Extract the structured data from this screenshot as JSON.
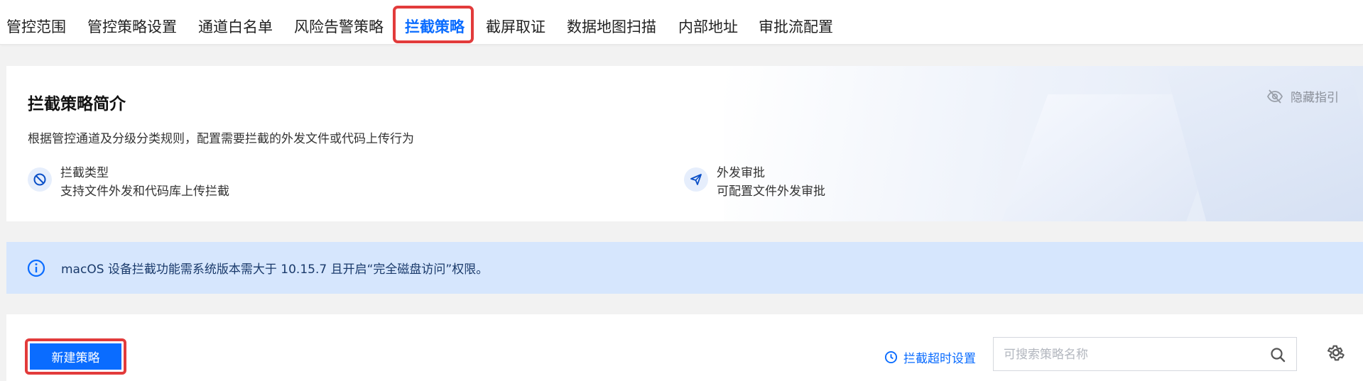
{
  "tabs": [
    {
      "label": "管控范围"
    },
    {
      "label": "管控策略设置"
    },
    {
      "label": "通道白名单"
    },
    {
      "label": "风险告警策略"
    },
    {
      "label": "拦截策略",
      "active": true
    },
    {
      "label": "截屏取证"
    },
    {
      "label": "数据地图扫描"
    },
    {
      "label": "内部地址"
    },
    {
      "label": "审批流配置"
    }
  ],
  "intro": {
    "title": "拦截策略简介",
    "description": "根据管控通道及分级分类规则，配置需要拦截的外发文件或代码上传行为",
    "hide_guide_label": "隐藏指引",
    "features": [
      {
        "icon": "block-icon",
        "title": "拦截类型",
        "desc": "支持文件外发和代码库上传拦截"
      },
      {
        "icon": "send-icon",
        "title": "外发审批",
        "desc": "可配置文件外发审批"
      }
    ]
  },
  "notice": {
    "text": "macOS 设备拦截功能需系统版本需大于 10.15.7 且开启“完全磁盘访问”权限。"
  },
  "toolbar": {
    "new_button": "新建策略",
    "timeout_link": "拦截超时设置",
    "search_placeholder": "可搜索策略名称"
  },
  "colors": {
    "accent": "#0a6cff",
    "highlight": "#e23b3b",
    "notice_bg": "#d6e6fd"
  }
}
